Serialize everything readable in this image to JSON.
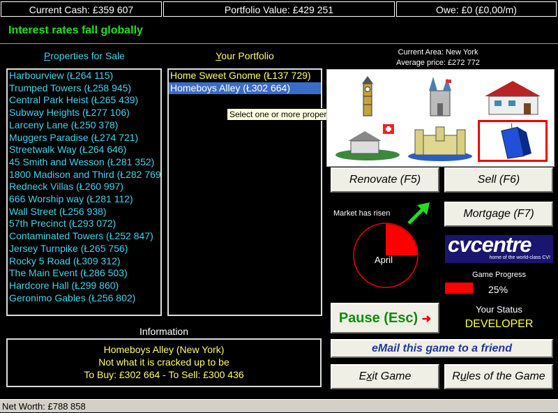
{
  "top": {
    "cash": "Current Cash: £359 607",
    "portfolio_value": "Portfolio Value: £429 251",
    "owe": "Owe: £0 (£0,00/m)"
  },
  "headline": "Interest rates fall globally",
  "for_sale": {
    "header_first": "P",
    "header_rest": "roperties for Sale",
    "items": [
      "Harbourview (Ł264 115)",
      "Trumped Towers (Ł258 945)",
      "Central Park Heist (Ł265 439)",
      "Subway Heights (Ł277 106)",
      "Larceny Lane (Ł250 378)",
      "Muggers Paradise (Ł274 721)",
      "Streetwalk Way (Ł264 646)",
      "45 Smith and Wesson (Ł281 352)",
      "1800 Madison and Third (Ł282 769",
      "Redneck Villas (Ł260 997)",
      "666 Worship way (Ł281 112)",
      "Wall Street (Ł256 938)",
      "57th Precinct  (Ł293 072)",
      "Contaminated Towers (Ł252 847)",
      "Jersey Turnpike (Ł265 756)",
      "Rocky 5 Road  (Ł309 312)",
      "The Main Event (Ł286 503)",
      "Hardcore Hall (Ł299 860)",
      "Geronimo Gables (Ł256 802)"
    ]
  },
  "portfolio": {
    "header_first": "Y",
    "header_rest": "our Portfolio",
    "items": [
      "Home Sweet Gnome (Ł137 729)",
      "Homeboys Alley (Ł302 664)"
    ],
    "selected_index": 1,
    "tooltip": "Select one or more properties"
  },
  "area": {
    "current": "Current Area: New York",
    "average": "Average price: £272 772",
    "tiles": [
      "big-ben",
      "castle-spires",
      "farmhouse",
      "swiss-chalet",
      "walled-castle",
      "skyscraper"
    ],
    "selected_tile": 5
  },
  "buttons": {
    "renovate": "Renovate (F5)",
    "sell": "Sell (F6)",
    "mortgage": "Mortgage (F7)",
    "pause": "Pause (Esc)",
    "email": "eMail this game to a friend",
    "exit_pre": "E",
    "exit_u": "x",
    "exit_post": "it Game",
    "rules_pre": "R",
    "rules_u": "u",
    "rules_post": "les of the Game"
  },
  "market": {
    "text": "Market has risen",
    "month": "April",
    "year_fraction": 0.25,
    "arrow": "up-right-arrow"
  },
  "logo": {
    "name": "cvcentre",
    "tagline": "home of the world-class CV!"
  },
  "progress": {
    "label": "Game Progress",
    "value": "25%"
  },
  "status": {
    "label": "Your Status",
    "value": "DEVELOPER"
  },
  "information": {
    "title": "Information",
    "line1": "Homeboys Alley (New York)",
    "line2": "Not what it is cracked up to be",
    "line3": "To Buy: £302 664 - To Sell: £300 436"
  },
  "statusbar": "Net Worth: £788 858",
  "colors": {
    "headline": "#22e01e",
    "sale_text": "#3fd4f0",
    "portfolio_text": "#ffff66",
    "selection": "#3c6cc8",
    "pie": "#ff0000",
    "status_value": "#ffff33"
  }
}
